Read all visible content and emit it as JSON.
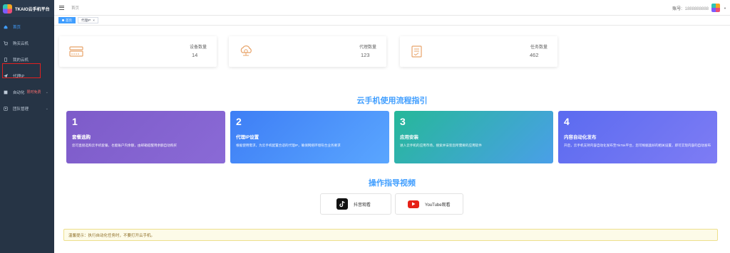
{
  "app": {
    "brand": "TKAIO云手机平台"
  },
  "sidebar": {
    "items": [
      {
        "label": "首页",
        "active": true
      },
      {
        "label": "购买云机"
      },
      {
        "label": "我的云机"
      },
      {
        "label": "代理IP"
      },
      {
        "label": "自动化",
        "tag": "限时免费"
      },
      {
        "label": "团队管理"
      }
    ]
  },
  "header": {
    "breadcrumb": "首页",
    "account_label": "账号:",
    "account_value": "1888888888"
  },
  "tags": [
    {
      "label": "首页",
      "active": true
    },
    {
      "label": "代理IP"
    }
  ],
  "stats": [
    {
      "title": "设备数量",
      "value": "14",
      "icon": "server-icon"
    },
    {
      "title": "代理数量",
      "value": "123",
      "icon": "cloud-network-icon"
    },
    {
      "title": "任务数量",
      "value": "462",
      "icon": "task-list-icon"
    }
  ],
  "guide": {
    "title": "云手机使用流程指引",
    "steps": [
      {
        "num": "1",
        "title": "套餐选购",
        "desc": "您可直接选购云手机套餐，也能账户内余额，由邮箱提醒用余额自动购买",
        "color_from": "#7d5bc9",
        "color_to": "#8a6ad6"
      },
      {
        "num": "2",
        "title": "代理IP设置",
        "desc": "根据使用需求，为云手机配置合适的代理IP，确保网络环境符合业务要求",
        "color_from": "#3e7ef5",
        "color_to": "#5aa6ff"
      },
      {
        "num": "3",
        "title": "应用安装",
        "desc": "进入云手机的应用市场，搜索并安装您所需要的应用软件",
        "color_from": "#26b899",
        "color_to": "#4a9fe8"
      },
      {
        "num": "4",
        "title": "内容自动化发布",
        "desc": "开启，云手机支持内容自动化发布至TikTok平台，您可根据喜好的相关设置，即可实现内容的自动发布",
        "color_from": "#5b6bf0",
        "color_to": "#7e7cf4"
      }
    ]
  },
  "videos": {
    "title": "操作指导视频",
    "buttons": [
      {
        "label": "抖音观看",
        "icon": "tiktok-icon",
        "color": "#111111"
      },
      {
        "label": "YouTube观看",
        "icon": "youtube-icon",
        "color": "#e62117"
      }
    ]
  },
  "notice": {
    "text": "温馨提示：执行自动化任务时，不要打开云手机。"
  },
  "colors": {
    "accent": "#409eff",
    "sidebar_bg": "#263445",
    "stat_icon": "#e8a46a"
  }
}
